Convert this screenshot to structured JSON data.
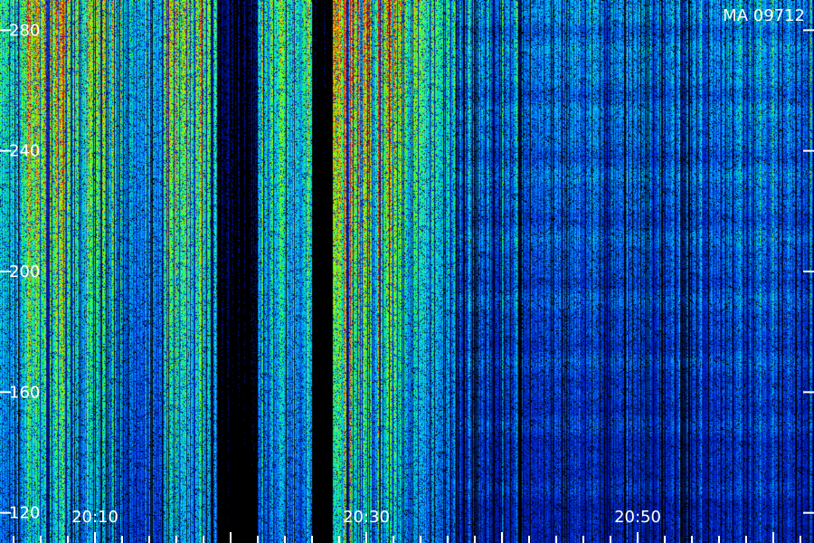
{
  "chart_data": {
    "type": "heatmap",
    "title": "MA 09712",
    "xlabel": "",
    "ylabel": "",
    "x_tick_labels": [
      "20:10",
      "20:30",
      "20:50"
    ],
    "y_tick_labels": [
      "120",
      "160",
      "200",
      "240",
      "280"
    ],
    "ylim": [
      110,
      290
    ],
    "x_start": "20:03",
    "x_end": "21:03",
    "colormap": [
      "#00003c",
      "#0020c8",
      "#0096ff",
      "#00f0c8",
      "#50ff00",
      "#e6f000",
      "#ff6400",
      "#dc0000"
    ],
    "regions": [
      {
        "from": "20:03",
        "to": "20:05",
        "intensity": 0.45
      },
      {
        "from": "20:05",
        "to": "20:08",
        "intensity": 0.78
      },
      {
        "from": "20:08",
        "to": "20:12",
        "intensity": 0.55
      },
      {
        "from": "20:12",
        "to": "20:15",
        "intensity": 0.35
      },
      {
        "from": "20:15",
        "to": "20:18",
        "intensity": 0.68
      },
      {
        "from": "20:18",
        "to": "20:19",
        "intensity": 0.5
      },
      {
        "from": "20:19",
        "to": "20:22",
        "intensity": 0.08
      },
      {
        "from": "20:22",
        "to": "20:24",
        "intensity": 0.5
      },
      {
        "from": "20:24",
        "to": "20:26",
        "intensity": 0.45
      },
      {
        "from": "20:26",
        "to": "20:27.5",
        "intensity": 0.05
      },
      {
        "from": "20:27.5",
        "to": "20:30",
        "intensity": 0.8
      },
      {
        "from": "20:30",
        "to": "20:33",
        "intensity": 0.72
      },
      {
        "from": "20:33",
        "to": "20:35",
        "intensity": 0.55
      },
      {
        "from": "20:35",
        "to": "20:36.5",
        "intensity": 0.45
      },
      {
        "from": "20:36.5",
        "to": "21:03",
        "intensity": 0.3
      }
    ]
  }
}
